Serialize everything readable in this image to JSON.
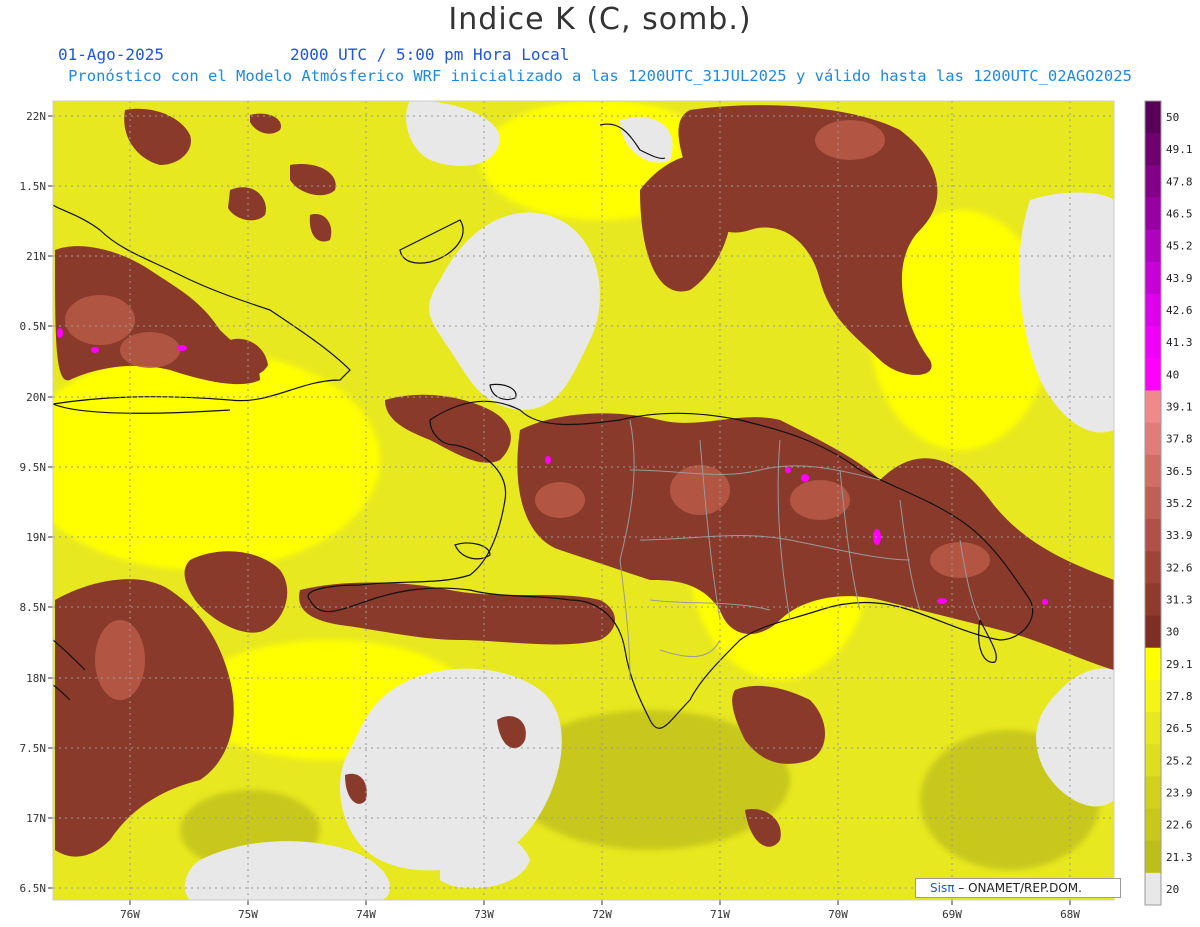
{
  "header": {
    "title": "Indice K (C, somb.)",
    "date": "01-Ago-2025",
    "time": "2000 UTC / 5:00 pm Hora Local",
    "subtitle": "Pronóstico con el Modelo Atmósferico WRF inicializado a las 1200UTC_31JUL2025 y válido hasta las  1200UTC_02AGO2025"
  },
  "axes": {
    "lat_labels": [
      "22N",
      "1.5N",
      "21N",
      "0.5N",
      "20N",
      "9.5N",
      "19N",
      "8.5N",
      "18N",
      "7.5N",
      "17N",
      "6.5N"
    ],
    "lon_labels": [
      "76W",
      "75W",
      "74W",
      "73W",
      "72W",
      "71W",
      "70W",
      "69W",
      "68W"
    ]
  },
  "colorbar": {
    "labels": [
      "50",
      "49.1",
      "47.8",
      "46.5",
      "45.2",
      "43.9",
      "42.6",
      "41.3",
      "40",
      "39.1",
      "37.8",
      "36.5",
      "35.2",
      "33.9",
      "32.6",
      "31.3",
      "30",
      "29.1",
      "27.8",
      "26.5",
      "25.2",
      "23.9",
      "22.6",
      "21.3",
      "20"
    ],
    "colors": [
      "#5a005a",
      "#6e0070",
      "#840088",
      "#9800a4",
      "#b000c0",
      "#c800d8",
      "#de00ea",
      "#f000f8",
      "#ff00ff",
      "#f08a8a",
      "#e07d78",
      "#d06e66",
      "#c05f56",
      "#b05048",
      "#a0443a",
      "#903a2e",
      "#7e2e22",
      "#ffff00",
      "#f4f418",
      "#e8e820",
      "#dede20",
      "#d2d21e",
      "#c8c81c",
      "#bebe1a",
      "#e8e8e8"
    ]
  },
  "credit": {
    "brand": "Sisπ",
    "text": "– ONAMET/REP.DOM."
  },
  "colors": {
    "land_low": "#e8e820",
    "ocean_high": "#ffff00",
    "low_fill": "#e8e8e8",
    "high_fill": "#8a3a2a"
  }
}
